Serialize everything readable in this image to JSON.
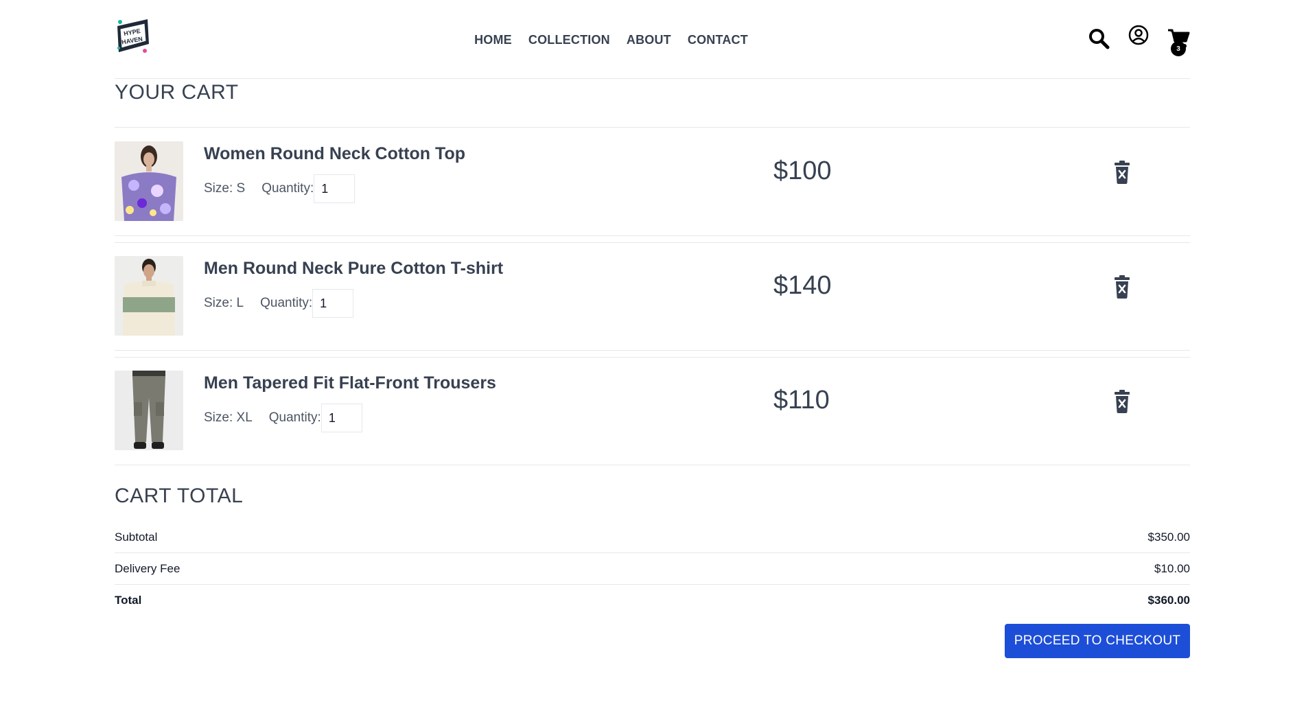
{
  "brand": {
    "logo_text": "HYPE HAVEN"
  },
  "nav": {
    "items": [
      "HOME",
      "COLLECTION",
      "ABOUT",
      "CONTACT"
    ]
  },
  "header_icons": {
    "search": "search-icon",
    "account": "user-circle-icon",
    "cart": "shopping-cart-icon",
    "cart_count": "3"
  },
  "cart": {
    "title": "YOUR CART",
    "items": [
      {
        "name": "Women Round Neck Cotton Top",
        "size_label": "Size: S",
        "quantity_label": "Quantity:",
        "quantity": "1",
        "price": "$100",
        "image": "floral-top-image"
      },
      {
        "name": "Men Round Neck Pure Cotton T-shirt",
        "size_label": "Size: L",
        "quantity_label": "Quantity:",
        "quantity": "1",
        "price": "$140",
        "image": "striped-sweatshirt-image"
      },
      {
        "name": "Men Tapered Fit Flat-Front Trousers",
        "size_label": "Size: XL",
        "quantity_label": "Quantity:",
        "quantity": "1",
        "price": "$110",
        "image": "grey-trousers-image"
      }
    ]
  },
  "totals": {
    "title": "CART TOTAL",
    "subtotal_label": "Subtotal",
    "subtotal": "$350.00",
    "delivery_label": "Delivery Fee",
    "delivery": "$10.00",
    "total_label": "Total",
    "total": "$360.00"
  },
  "checkout": {
    "label": "PROCEED TO CHECKOUT"
  },
  "colors": {
    "accent": "#1d4ed8",
    "text": "#374151",
    "divider": "#e5e7eb"
  }
}
